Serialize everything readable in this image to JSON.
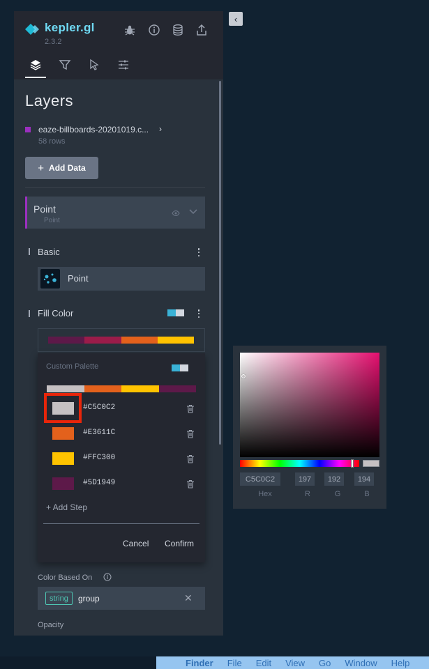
{
  "app": {
    "name": "kepler.gl",
    "version": "2.3.2",
    "collapse_glyph": "‹"
  },
  "header_icons": [
    "bug-icon",
    "info-icon",
    "database-icon",
    "share-icon"
  ],
  "tabs": [
    "layers",
    "filters",
    "interactions",
    "map-settings"
  ],
  "panel": {
    "title": "Layers",
    "dataset": {
      "name": "eaze-billboards-20201019.c...",
      "rows": "58 rows",
      "color": "#9b2fbf"
    },
    "add_data_label": "Add Data",
    "layer": {
      "name": "Point",
      "type": "Point"
    },
    "basic": {
      "label": "Basic",
      "layer_type_label": "Point"
    },
    "fill_color": {
      "label": "Fill Color",
      "ramp": [
        "#5d1949",
        "#9b1c4a",
        "#e3611c",
        "#ffc300"
      ]
    },
    "custom_palette": {
      "label": "Custom Palette",
      "bar": [
        "#c5c0c2",
        "#e3611c",
        "#ffc300",
        "#5d1949"
      ],
      "steps": [
        {
          "hex": "#C5C0C2",
          "color": "#c5c0c2"
        },
        {
          "hex": "#E3611C",
          "color": "#e3611c"
        },
        {
          "hex": "#FFC300",
          "color": "#ffc300"
        },
        {
          "hex": "#5D1949",
          "color": "#5d1949"
        }
      ],
      "add_step_label": "+ Add Step",
      "cancel_label": "Cancel",
      "confirm_label": "Confirm"
    },
    "color_based_on": {
      "label": "Color Based On",
      "tag": "string",
      "value": "group",
      "clear_glyph": "✕"
    },
    "opacity_label": "Opacity"
  },
  "picker": {
    "hex": "C5C0C2",
    "r": "197",
    "g": "192",
    "b": "194",
    "labels": {
      "hex": "Hex",
      "r": "R",
      "g": "G",
      "b": "B"
    }
  },
  "menubar": {
    "apple": "",
    "items": [
      "Finder",
      "File",
      "Edit",
      "View",
      "Go",
      "Window",
      "Help"
    ]
  }
}
